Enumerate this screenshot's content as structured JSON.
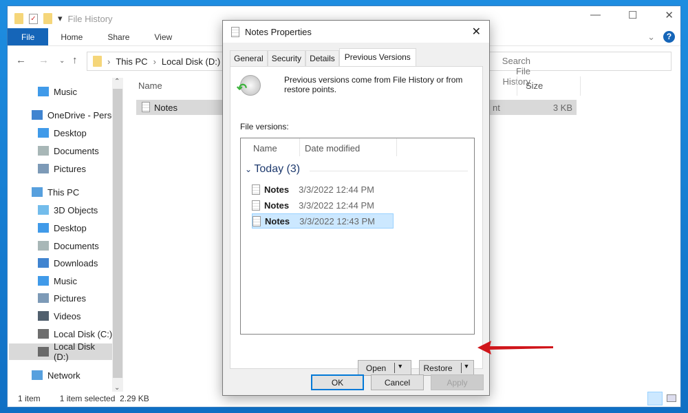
{
  "explorer": {
    "title": "File History",
    "ribbon_tabs": [
      "File",
      "Home",
      "Share",
      "View"
    ],
    "breadcrumb": [
      "This PC",
      "Local Disk (D:)"
    ],
    "search_placeholder": "Search File History",
    "columns": {
      "name": "Name",
      "size": "Size"
    },
    "files": [
      {
        "name": "Notes",
        "type_partial": "nt",
        "size": "3 KB"
      }
    ],
    "sidebar": [
      {
        "label": "Music",
        "icon": "music-icon"
      },
      {
        "label": "OneDrive - Persor",
        "icon": "cloud-icon"
      },
      {
        "label": "Desktop",
        "icon": "desktop-icon"
      },
      {
        "label": "Documents",
        "icon": "documents-icon"
      },
      {
        "label": "Pictures",
        "icon": "pictures-icon"
      },
      {
        "label": "This PC",
        "icon": "pc-icon"
      },
      {
        "label": "3D Objects",
        "icon": "cube-icon"
      },
      {
        "label": "Desktop",
        "icon": "desktop-icon"
      },
      {
        "label": "Documents",
        "icon": "documents-icon"
      },
      {
        "label": "Downloads",
        "icon": "download-icon"
      },
      {
        "label": "Music",
        "icon": "music-icon"
      },
      {
        "label": "Pictures",
        "icon": "pictures-icon"
      },
      {
        "label": "Videos",
        "icon": "video-icon"
      },
      {
        "label": "Local Disk (C:)",
        "icon": "drive-icon"
      },
      {
        "label": "Local Disk (D:)",
        "icon": "drive-icon"
      },
      {
        "label": "Network",
        "icon": "network-icon"
      }
    ],
    "status": {
      "count": "1 item",
      "selected": "1 item selected",
      "size": "2.29 KB"
    }
  },
  "dialog": {
    "title": "Notes Properties",
    "tabs": [
      "General",
      "Security",
      "Details",
      "Previous Versions"
    ],
    "info": "Previous versions come from File History or from restore points.",
    "file_versions_label": "File versions:",
    "list_columns": {
      "name": "Name",
      "date": "Date modified"
    },
    "group": "Today (3)",
    "versions": [
      {
        "name": "Notes",
        "date": "3/3/2022 12:44 PM"
      },
      {
        "name": "Notes",
        "date": "3/3/2022 12:44 PM"
      },
      {
        "name": "Notes",
        "date": "3/3/2022 12:43 PM"
      }
    ],
    "buttons": {
      "open": "Open",
      "restore": "Restore",
      "ok": "OK",
      "cancel": "Cancel",
      "apply": "Apply"
    }
  },
  "colors": {
    "accent": "#1565b8",
    "arrow": "#d0161b",
    "selection": "#cce8ff"
  }
}
